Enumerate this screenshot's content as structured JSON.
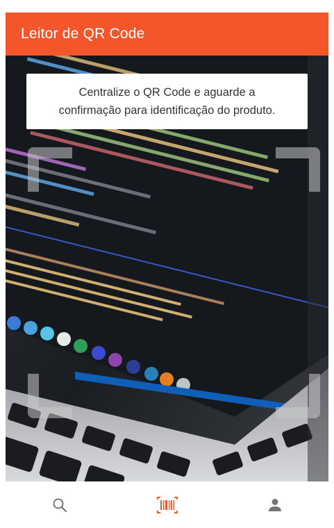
{
  "header": {
    "title": "Leitor de QR Code"
  },
  "instruction": {
    "line1": "Centralize o QR Code e aguarde a",
    "line2": "confirmação para identificação do produto."
  },
  "tabs": [
    {
      "name": "search",
      "icon": "search-icon",
      "active": false
    },
    {
      "name": "scanner",
      "icon": "barcode-scan-icon",
      "active": true
    },
    {
      "name": "profile",
      "icon": "person-icon",
      "active": false
    }
  ],
  "colors": {
    "header_bg": "#f4562b",
    "active_tab": "#f4562b",
    "inactive_tab": "#757575"
  }
}
